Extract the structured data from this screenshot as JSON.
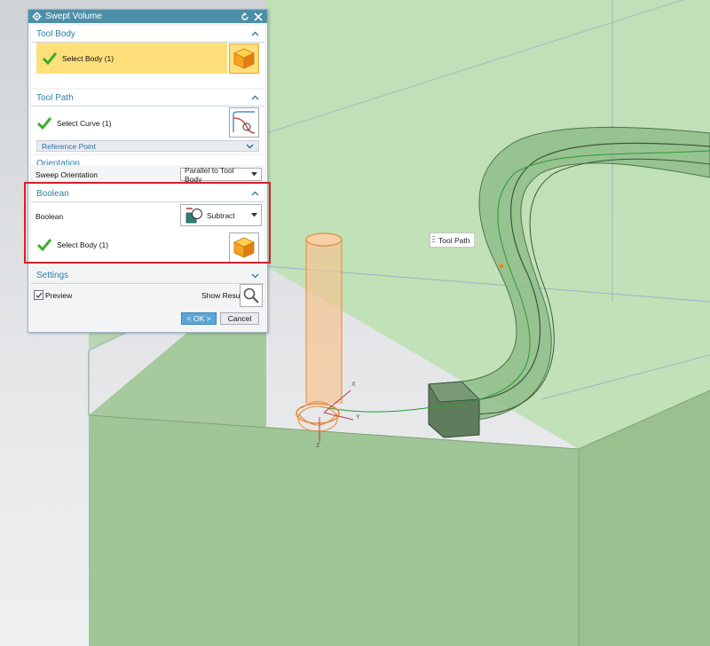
{
  "dialog": {
    "title": "Swept Volume"
  },
  "tool_body": {
    "header": "Tool Body",
    "select_label": "Select Body (1)"
  },
  "tool_path": {
    "header": "Tool Path",
    "select_label": "Select Curve (1)",
    "reference_point_label": "Reference Point"
  },
  "orientation": {
    "header": "Orientation",
    "sweep_label": "Sweep Orientation",
    "sweep_value": "Parallel to Tool Body"
  },
  "boolean": {
    "header": "Boolean",
    "boolean_label": "Boolean",
    "boolean_value": "Subtract",
    "select_label": "Select Body (1)"
  },
  "settings": {
    "header": "Settings",
    "preview_label": "Preview",
    "preview_checked": true,
    "show_result_label": "Show Result"
  },
  "buttons": {
    "ok_label": "< OK >",
    "cancel_label": "Cancel"
  },
  "viewport": {
    "tool_path_label": "Tool Path",
    "axis_x": "X",
    "axis_y": "Y",
    "axis_z": "Z"
  },
  "colors": {
    "accent": "#2d7fa6",
    "titlebar": "#4d8fa8",
    "selected_row": "#ffdf7a",
    "highlight": "#d6202a",
    "body_green": "#a9cf9f",
    "tool_orange": "#f0a060"
  }
}
